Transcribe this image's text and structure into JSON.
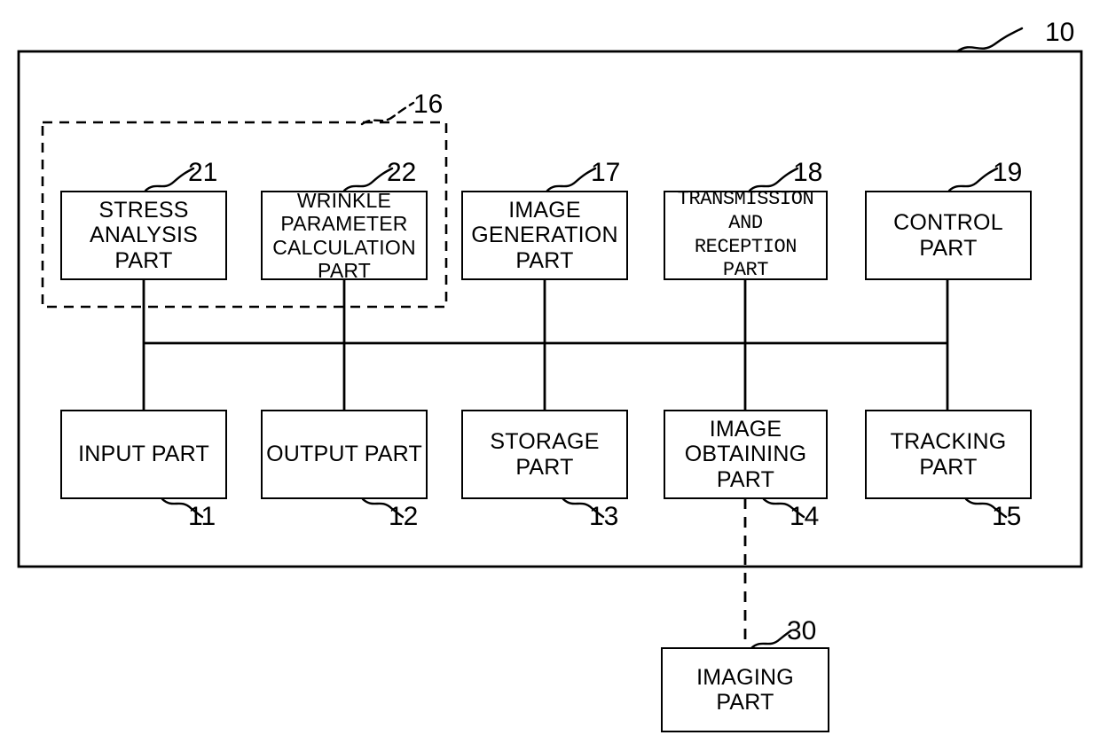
{
  "figure": {
    "kind": "patent-block-diagram",
    "stroke_color": "#000000",
    "background_color": "#ffffff"
  },
  "outer_enclosure": {
    "reference_numeral": "10",
    "style": "solid"
  },
  "dashed_group": {
    "reference_numeral": "16",
    "style": "dashed"
  },
  "blocks": [
    {
      "id": "stress-analysis-part",
      "label": "STRESS\nANALYSIS\nPART",
      "reference_numeral": "21",
      "ref_position": "top-right",
      "font": "sans"
    },
    {
      "id": "wrinkle-parameter-calculation-part",
      "label": "WRINKLE\nPARAMETER\nCALCULATION\nPART",
      "reference_numeral": "22",
      "ref_position": "top-right",
      "font": "sans"
    },
    {
      "id": "image-generation-part",
      "label": "IMAGE\nGENERATION\nPART",
      "reference_numeral": "17",
      "ref_position": "top-right",
      "font": "sans"
    },
    {
      "id": "transmission-and-reception-part",
      "label": "TRANSMISSION\nAND\nRECEPTION PART",
      "reference_numeral": "18",
      "ref_position": "top-right",
      "font": "mono"
    },
    {
      "id": "control-part",
      "label": "CONTROL\nPART",
      "reference_numeral": "19",
      "ref_position": "top-right",
      "font": "sans"
    },
    {
      "id": "input-part",
      "label": "INPUT PART",
      "reference_numeral": "11",
      "ref_position": "bottom-right",
      "font": "sans"
    },
    {
      "id": "output-part",
      "label": "OUTPUT PART",
      "reference_numeral": "12",
      "ref_position": "bottom-right",
      "font": "sans"
    },
    {
      "id": "storage-part",
      "label": "STORAGE\nPART",
      "reference_numeral": "13",
      "ref_position": "bottom-right",
      "font": "sans"
    },
    {
      "id": "image-obtaining-part",
      "label": "IMAGE\nOBTAINING\nPART",
      "reference_numeral": "14",
      "ref_position": "bottom-right",
      "font": "sans"
    },
    {
      "id": "tracking-part",
      "label": "TRACKING\nPART",
      "reference_numeral": "15",
      "ref_position": "bottom-right",
      "font": "sans"
    },
    {
      "id": "imaging-part",
      "label": "IMAGING\nPART",
      "reference_numeral": "30",
      "ref_position": "top-right",
      "font": "sans"
    }
  ],
  "connections": [
    {
      "from": "stress-analysis-part",
      "to": "bus",
      "style": "solid"
    },
    {
      "from": "wrinkle-parameter-calculation-part",
      "to": "bus",
      "style": "solid"
    },
    {
      "from": "image-generation-part",
      "to": "bus",
      "style": "solid"
    },
    {
      "from": "transmission-and-reception-part",
      "to": "bus",
      "style": "solid"
    },
    {
      "from": "control-part",
      "to": "bus",
      "style": "solid"
    },
    {
      "from": "bus",
      "to": "input-part",
      "style": "solid"
    },
    {
      "from": "bus",
      "to": "output-part",
      "style": "solid"
    },
    {
      "from": "bus",
      "to": "storage-part",
      "style": "solid"
    },
    {
      "from": "bus",
      "to": "image-obtaining-part",
      "style": "solid"
    },
    {
      "from": "bus",
      "to": "tracking-part",
      "style": "solid"
    },
    {
      "from": "image-obtaining-part",
      "to": "imaging-part",
      "style": "dashed"
    }
  ]
}
